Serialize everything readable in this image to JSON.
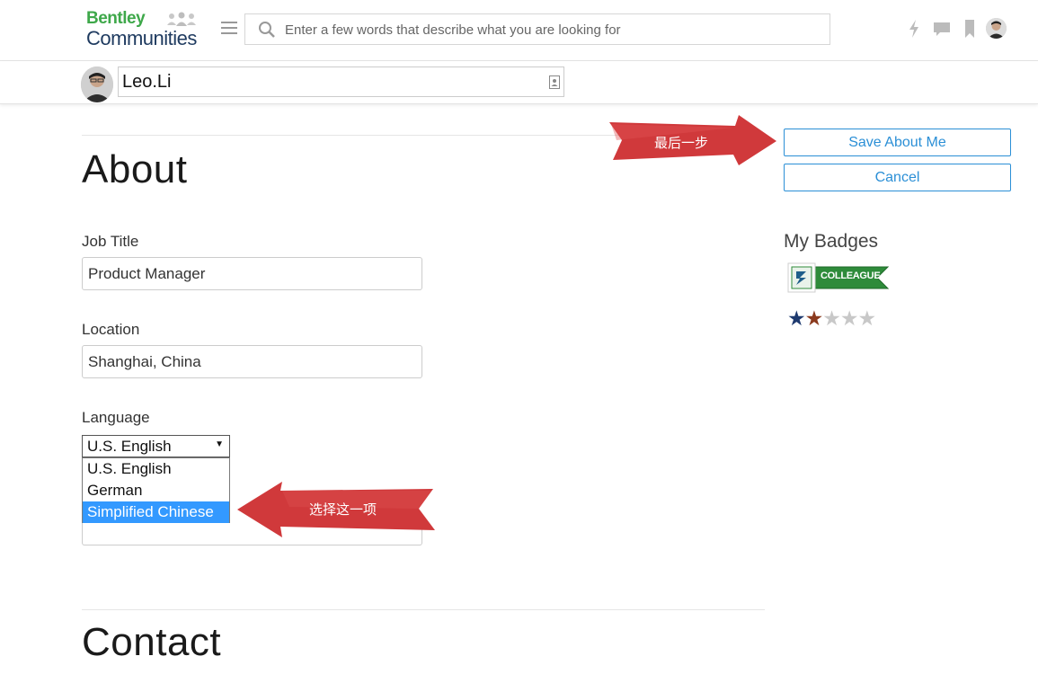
{
  "header": {
    "logo_line1": "Bentley",
    "logo_line2": "Communities",
    "search_placeholder": "Enter a few words that describe what you are looking for"
  },
  "profile": {
    "name": "Leo.Li"
  },
  "about": {
    "heading": "About",
    "job_title_label": "Job Title",
    "job_title_value": "Product Manager",
    "location_label": "Location",
    "location_value": "Shanghai, China",
    "language_label": "Language",
    "language_selected": "U.S. English",
    "language_options": [
      "U.S. English",
      "German",
      "Simplified Chinese"
    ],
    "language_highlighted": "Simplified Chinese"
  },
  "contact": {
    "heading": "Contact"
  },
  "sidebar": {
    "save_label": "Save About Me",
    "cancel_label": "Cancel",
    "badges_title": "My Badges",
    "badge_text": "COLLEAGUE",
    "rating_filled": 2,
    "rating_total": 5
  },
  "annotations": {
    "arrow_top_text": "最后一步",
    "arrow_bottom_text": "选择这一项"
  },
  "colors": {
    "accent": "#2b8fd6",
    "brand_green": "#3ea84a",
    "brand_navy": "#1e3a5f",
    "annotation_red": "#d0393b",
    "select_highlight": "#3399ff"
  }
}
